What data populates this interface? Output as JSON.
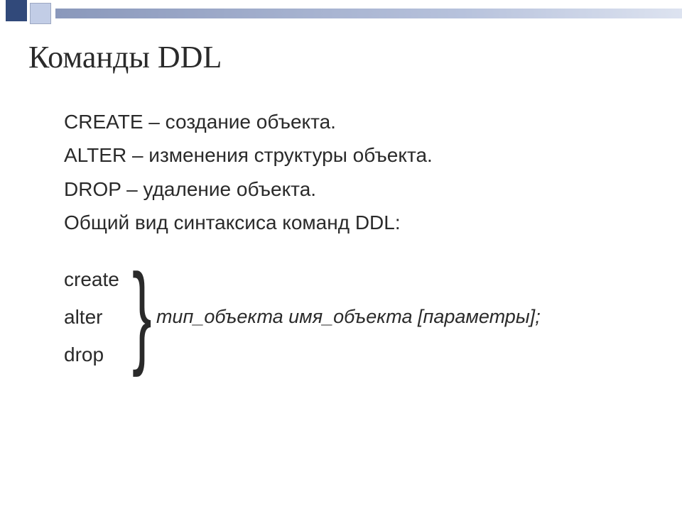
{
  "title": "Команды DDL",
  "lines": {
    "create": "CREATE – создание объекта.",
    "alter": "ALTER – изменения структуры объекта.",
    "drop": "DROP – удаление объекта.",
    "syntax_intro": "Общий вид синтаксиса команд DDL:"
  },
  "syntax": {
    "cmds": [
      "create",
      "alter",
      "drop"
    ],
    "brace": "}",
    "tail": "тип_объекта  имя_объекта  [параметры];"
  }
}
